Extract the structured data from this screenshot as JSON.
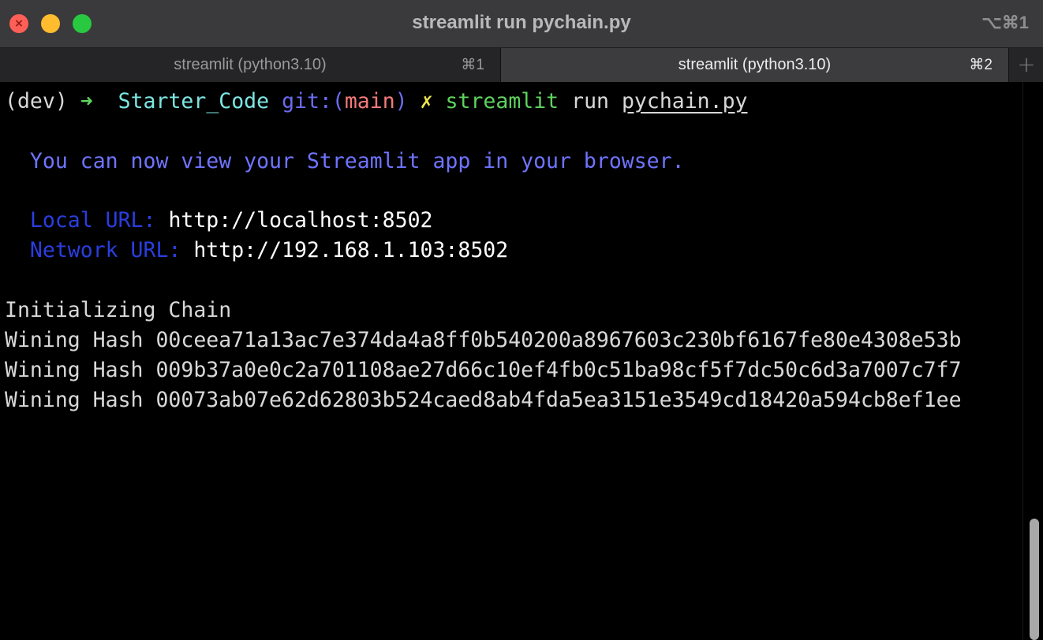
{
  "window": {
    "title": "streamlit run pychain.py",
    "title_shortcut": "⌥⌘1",
    "traffic_lights": {
      "close_glyph": "×",
      "colors": {
        "close": "#fe5f57",
        "minimize": "#febc2e",
        "maximize": "#28c840"
      }
    }
  },
  "tabs": [
    {
      "label": "streamlit (python3.10)",
      "shortcut": "⌘1",
      "active": false
    },
    {
      "label": "streamlit (python3.10)",
      "shortcut": "⌘2",
      "active": true
    }
  ],
  "new_tab": {
    "label": "+"
  },
  "terminal": {
    "prompt": {
      "env": "(dev)",
      "arrow": "➜",
      "directory": "Starter_Code",
      "git_prefix": "git:(",
      "branch": "main",
      "git_suffix": ")",
      "dirty_marker": "✗",
      "command": "streamlit",
      "subcommand": "run",
      "argument": "pychain.py"
    },
    "info_message": "You can now view your Streamlit app in your browser.",
    "local_url_label": "Local URL:",
    "local_url": "http://localhost:8502",
    "network_url_label": "Network URL:",
    "network_url": "http://192.168.1.103:8502",
    "output_lines": [
      "Initializing Chain",
      "Wining Hash 00ceea71a13ac7e374da4a8ff0b540200a8967603c230bf6167fe80e4308e53b",
      "Wining Hash 009b37a0e0c2a701108ae27d66c10ef4fb0c51ba98cf5f7dc50c6d3a7007c7f7",
      "Wining Hash 00073ab07e62d62803b524caed8ab4fda5ea3151e3549cd18420a594cb8ef1ee"
    ]
  },
  "colors": {
    "prompt_arrow": "#5fd75f",
    "directory": "#7de6e3",
    "git": "#6b6bf2",
    "branch": "#f47a7a",
    "dirty_marker": "#f0e84c",
    "command": "#5ed35e",
    "info": "#6f74ff",
    "url_label": "#2a3ee0"
  }
}
